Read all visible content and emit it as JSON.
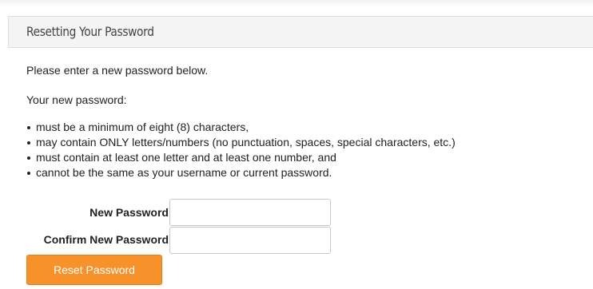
{
  "panel": {
    "title": "Resetting Your Password"
  },
  "instructions": {
    "intro": "Please enter a new password below.",
    "requirements_heading": "Your new password:",
    "requirements": [
      "must be a minimum of eight (8) characters,",
      "may contain ONLY letters/numbers (no punctuation, spaces, special characters, etc.)",
      "must contain at least one letter and at least one number, and",
      "cannot be the same as your username or current password."
    ]
  },
  "form": {
    "new_password_label": "New Password",
    "new_password_value": "",
    "confirm_password_label": "Confirm New Password",
    "confirm_password_value": "",
    "submit_label": "Reset Password"
  },
  "colors": {
    "button_bg": "#f7922b",
    "header_bg": "#f4f4f4"
  }
}
